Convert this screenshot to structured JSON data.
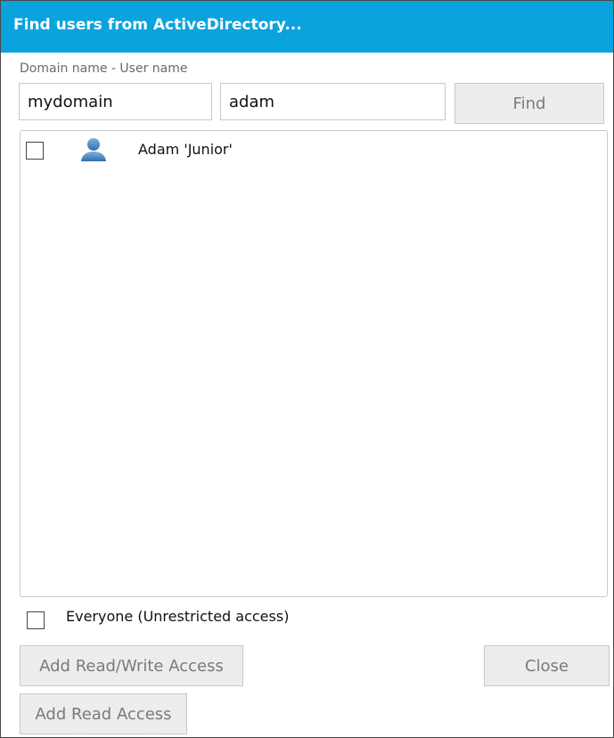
{
  "dialog": {
    "title": "Find users from ActiveDirectory...",
    "title_bar_color": "#0aa3de"
  },
  "search": {
    "field_label": "Domain name - User name",
    "domain_value": "mydomain",
    "username_value": "adam",
    "find_label": "Find"
  },
  "results": {
    "items": [
      {
        "label": "Adam 'Junior'",
        "icon": "user-icon",
        "checked": false
      }
    ]
  },
  "everyone": {
    "label": "Everyone (Unrestricted access)",
    "checked": false
  },
  "actions": {
    "add_rw_label": "Add Read/Write Access",
    "close_label": "Close",
    "add_read_label": "Add Read Access"
  }
}
